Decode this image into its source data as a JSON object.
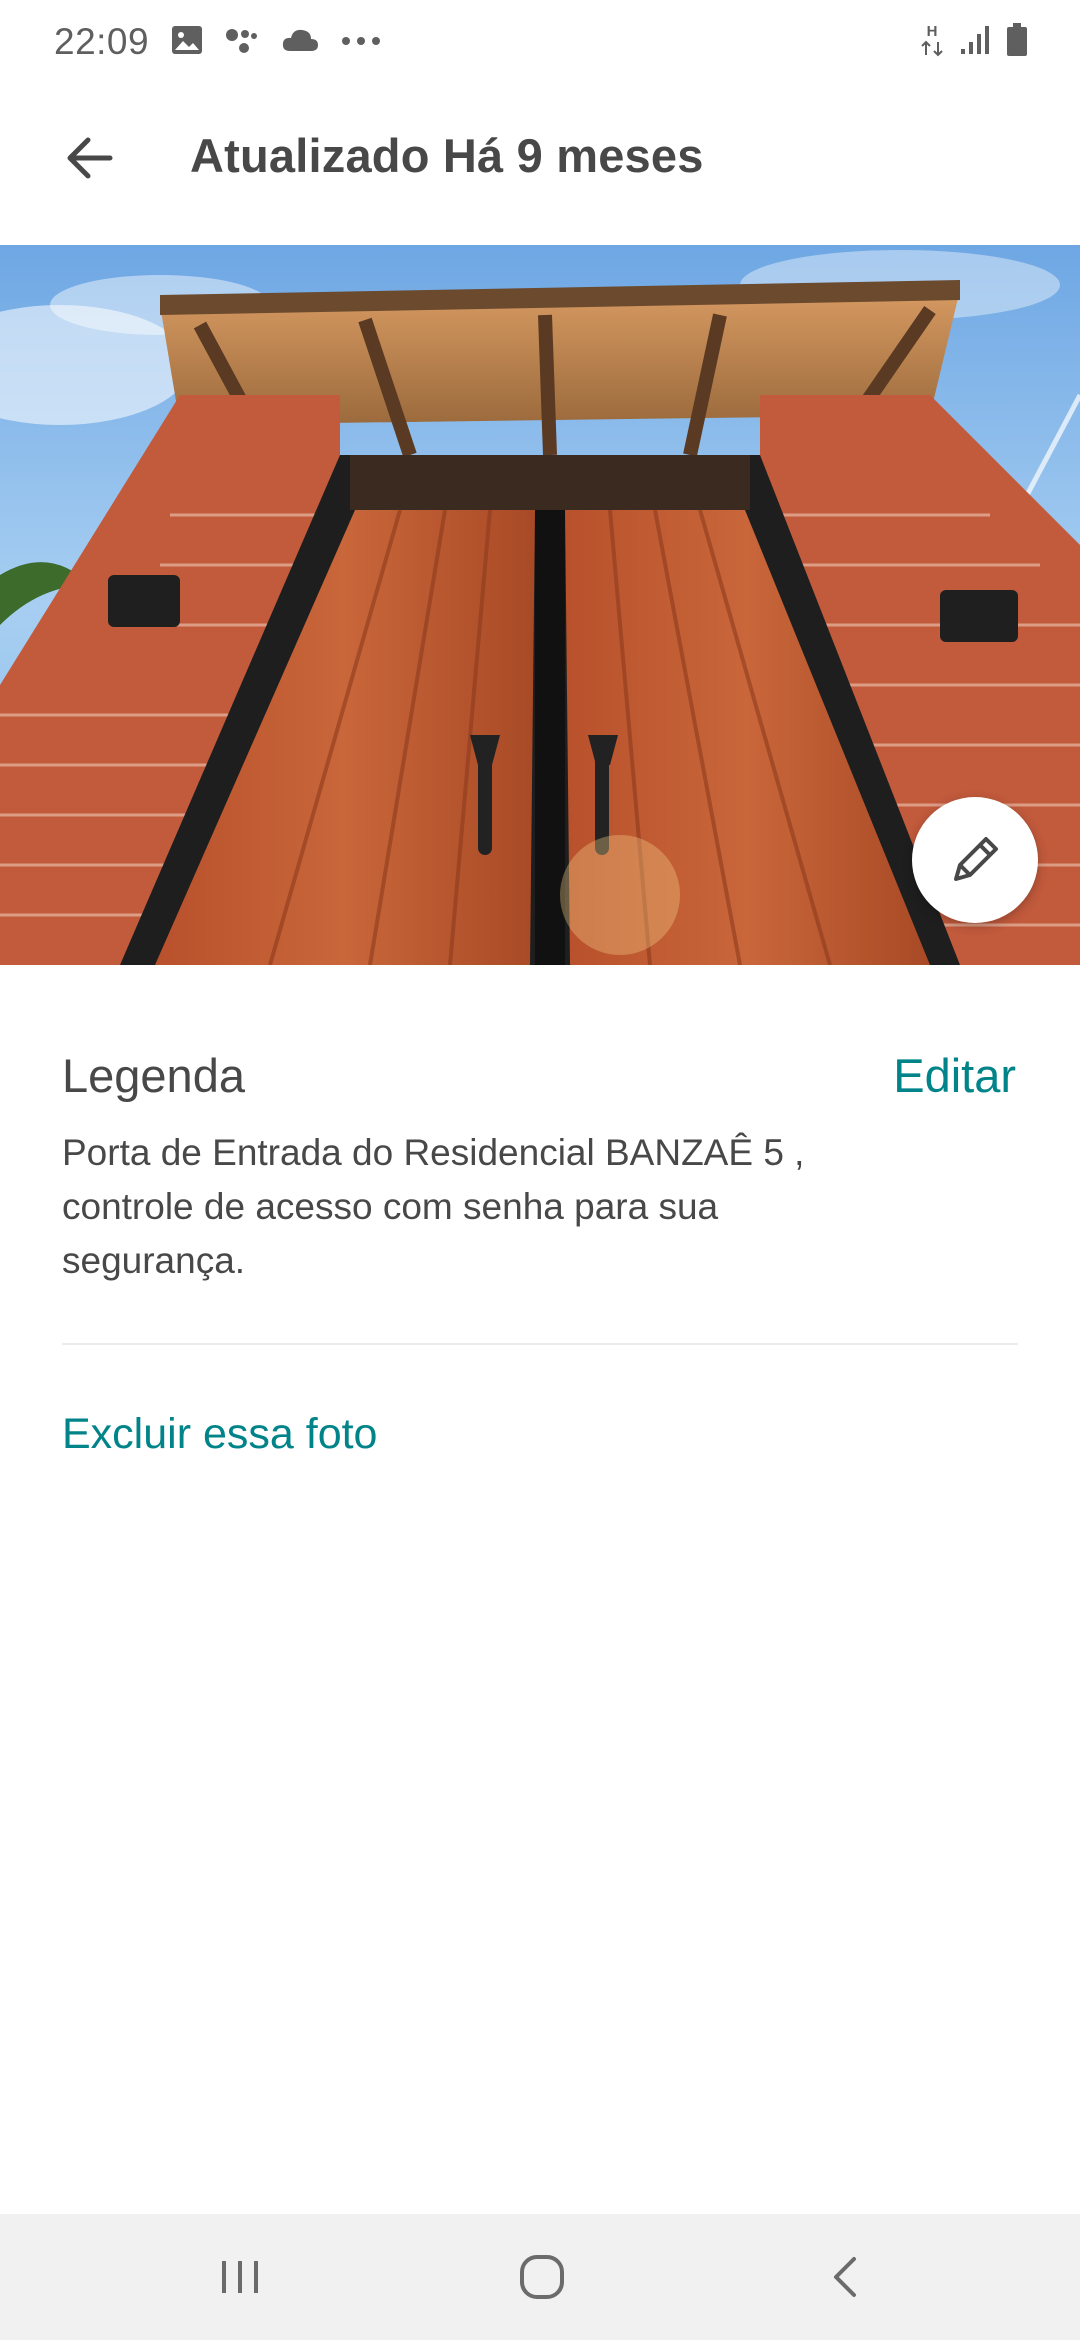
{
  "status_bar": {
    "time": "22:09",
    "left_icons": [
      "gallery-icon",
      "assistant-icon",
      "cloud-icon",
      "more-dots-icon"
    ],
    "right_icons": [
      "hspa-data-icon",
      "signal-icon",
      "battery-icon"
    ]
  },
  "toolbar": {
    "title": "Atualizado Há 9 meses",
    "back_icon": "arrow-left-icon"
  },
  "photo": {
    "description_icon": "pencil-icon"
  },
  "caption": {
    "heading": "Legenda",
    "edit_label": "Editar",
    "text": "Porta de Entrada do Residencial BANZAÊ 5 , controle de acesso com senha para sua segurança."
  },
  "actions": {
    "delete_label": "Excluir essa foto"
  },
  "nav_bar": {
    "icons": [
      "recent-apps-icon",
      "home-icon",
      "back-icon"
    ]
  },
  "colors": {
    "accent": "#008489",
    "text": "#484848",
    "divider": "#ebebeb"
  }
}
